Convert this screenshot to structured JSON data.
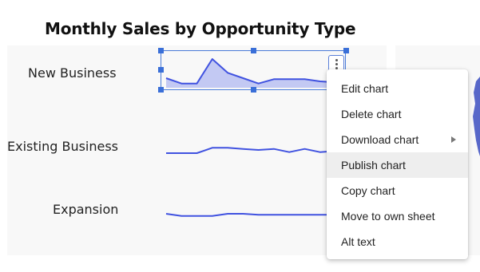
{
  "title": "Monthly Sales by Opportunity Type",
  "rows": [
    {
      "label": "New Business"
    },
    {
      "label": "Existing Business"
    },
    {
      "label": "Expansion"
    }
  ],
  "chart_data": [
    {
      "type": "area",
      "title": "",
      "series": [
        {
          "values": [
            9,
            4,
            4,
            27,
            14,
            9,
            4,
            8,
            8,
            8,
            6,
            5
          ]
        }
      ],
      "ylim": [
        0,
        30
      ]
    },
    {
      "type": "line",
      "title": "",
      "series": [
        {
          "values": [
            0,
            0,
            0,
            5,
            5,
            4,
            3,
            4,
            1,
            4,
            1,
            2
          ]
        }
      ],
      "ylim": [
        0,
        30
      ]
    },
    {
      "type": "line",
      "title": "",
      "series": [
        {
          "values": [
            3,
            1,
            1,
            1,
            3,
            3,
            2,
            2,
            2,
            2,
            2,
            2
          ]
        }
      ],
      "ylim": [
        0,
        30
      ]
    }
  ],
  "colors": {
    "line": "#4052e0",
    "fill": "#c3c9f3",
    "selection": "#4a7bd8"
  },
  "menu": {
    "items": [
      {
        "label": "Edit chart"
      },
      {
        "label": "Delete chart"
      },
      {
        "label": "Download chart",
        "has_submenu": true
      },
      {
        "label": "Publish chart",
        "hovered": true
      },
      {
        "label": "Copy chart"
      },
      {
        "label": "Move to own sheet"
      },
      {
        "label": "Alt text"
      }
    ]
  }
}
